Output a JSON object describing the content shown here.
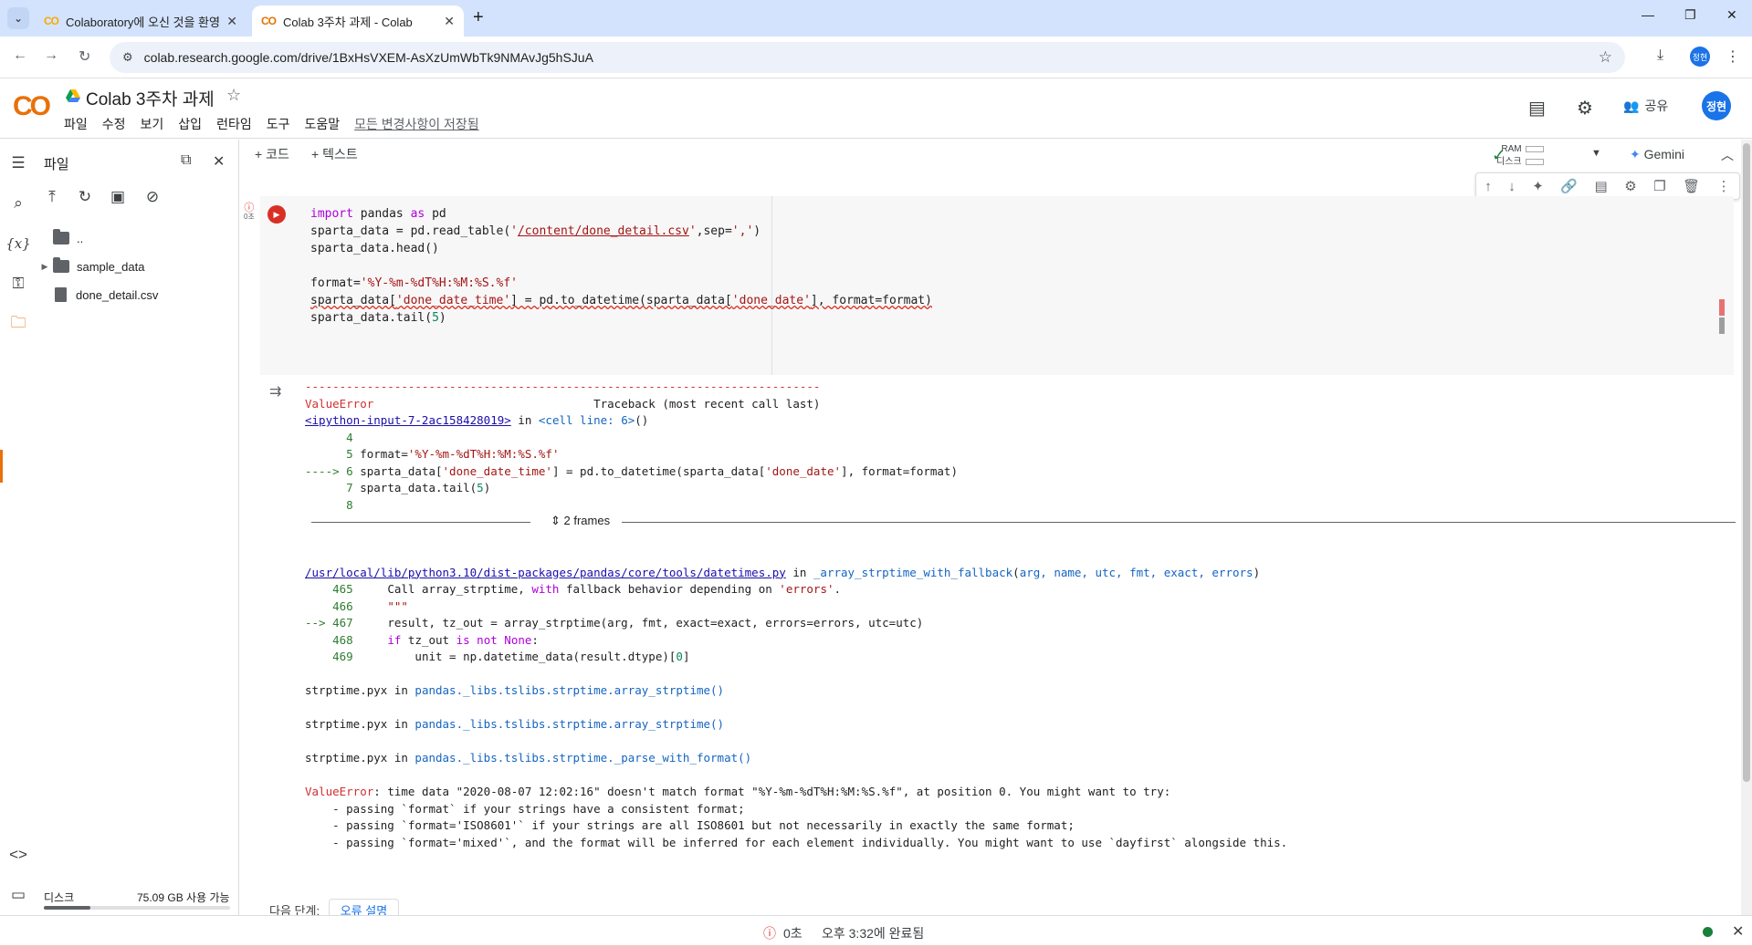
{
  "browser": {
    "tabs": [
      {
        "title": "Colaboratory에 오신 것을 환영",
        "active": false
      },
      {
        "title": "Colab 3주차 과제 - Colab",
        "active": true
      }
    ],
    "url": "colab.research.google.com/drive/1BxHsVXEM-AsXzUmWbTk9NMAvJg5hSJuA",
    "profile_initial": "정현"
  },
  "header": {
    "logo": "CO",
    "title": "Colab 3주차 과제",
    "menu": [
      "파일",
      "수정",
      "보기",
      "삽입",
      "런타임",
      "도구",
      "도움말"
    ],
    "save_status": "모든 변경사항이 저장됨",
    "share_label": "공유",
    "avatar": "정현"
  },
  "files": {
    "title": "파일",
    "entries": [
      {
        "name": "..",
        "type": "folder"
      },
      {
        "name": "sample_data",
        "type": "folder"
      },
      {
        "name": "done_detail.csv",
        "type": "file"
      }
    ],
    "disk_label": "디스크",
    "disk_value": "75.09 GB 사용 가능",
    "disk_used_fraction": 0.25
  },
  "toolbar": {
    "add_code": "+ 코드",
    "add_text": "+ 텍스트",
    "ram_label": "RAM",
    "disk_label": "디스크",
    "gemini": "Gemini"
  },
  "cell": {
    "exec_time": "0초"
  },
  "output": {
    "frames_label": "2 frames"
  },
  "next_steps": {
    "label": "다음 단계:",
    "button": "오류 설명"
  },
  "status": {
    "elapsed": "0초",
    "completed": "오후 3:32에 완료됨"
  }
}
